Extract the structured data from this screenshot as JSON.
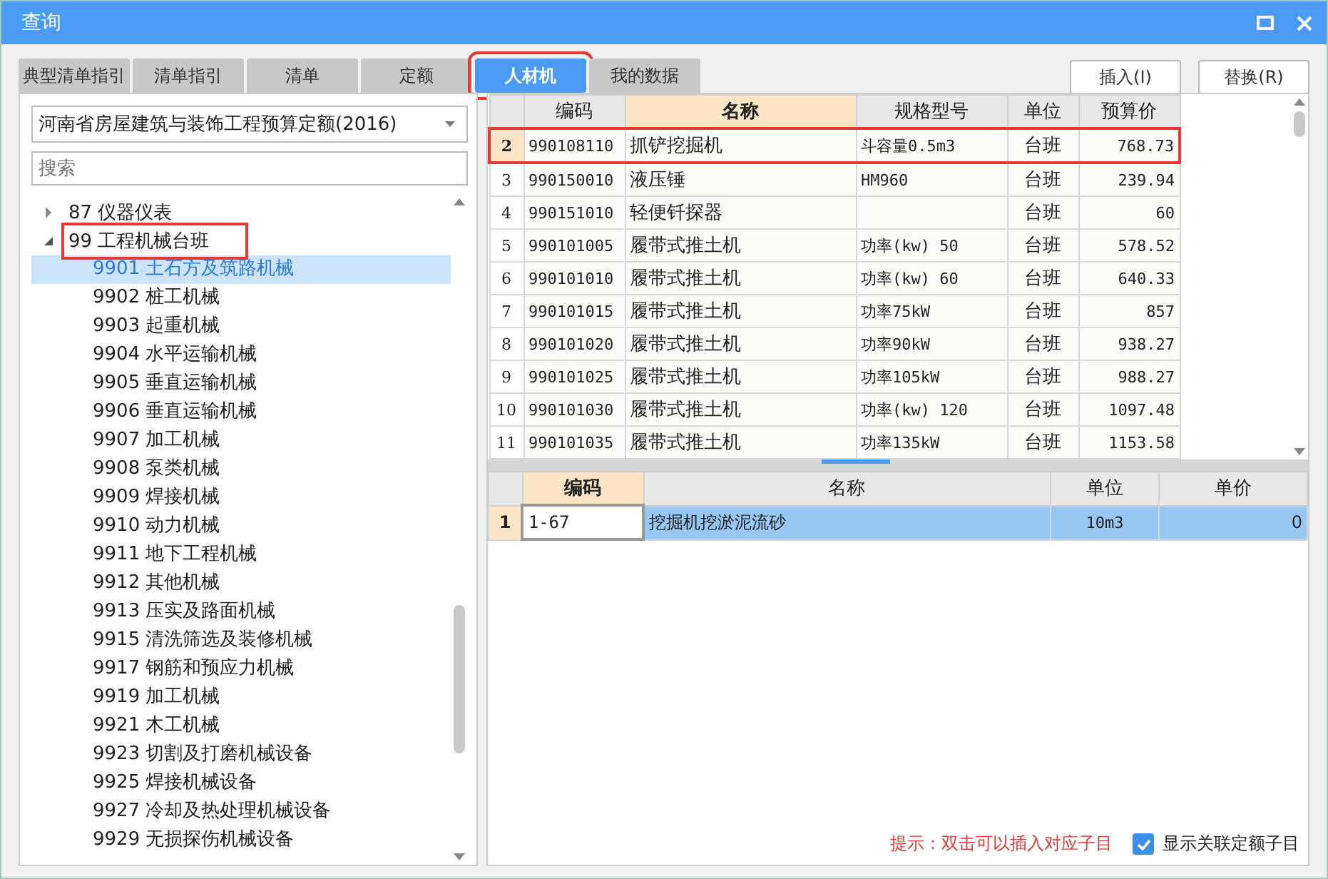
{
  "window": {
    "title": "查询"
  },
  "tabs": [
    {
      "label": "典型清单指引",
      "selected": false,
      "marked": false
    },
    {
      "label": "清单指引",
      "selected": false,
      "marked": false
    },
    {
      "label": "清单",
      "selected": false,
      "marked": false
    },
    {
      "label": "定额",
      "selected": false,
      "marked": false
    },
    {
      "label": "人材机",
      "selected": true,
      "marked": true
    },
    {
      "label": "我的数据",
      "selected": false,
      "marked": false
    }
  ],
  "actions": [
    "插入(I)",
    "替换(R)"
  ],
  "library": {
    "value": "河南省房屋建筑与装饰工程预算定额(2016)"
  },
  "search": {
    "placeholder": "搜索"
  },
  "tree": [
    {
      "label": "87 仪器仪表",
      "expanded": false,
      "selected": false,
      "marked": false
    },
    {
      "label": "99 工程机械台班",
      "expanded": true,
      "selected": false,
      "marked": true,
      "children": [
        {
          "label": "9901 土石方及筑路机械",
          "selected": true
        },
        {
          "label": "9902 桩工机械",
          "selected": false
        },
        {
          "label": "9903 起重机械",
          "selected": false
        },
        {
          "label": "9904 水平运输机械",
          "selected": false
        },
        {
          "label": "9905 垂直运输机械",
          "selected": false
        },
        {
          "label": "9906 垂直运输机械",
          "selected": false
        },
        {
          "label": "9907 加工机械",
          "selected": false
        },
        {
          "label": "9908 泵类机械",
          "selected": false
        },
        {
          "label": "9909 焊接机械",
          "selected": false
        },
        {
          "label": "9910 动力机械",
          "selected": false
        },
        {
          "label": "9911 地下工程机械",
          "selected": false
        },
        {
          "label": "9912 其他机械",
          "selected": false
        },
        {
          "label": "9913 压实及路面机械",
          "selected": false
        },
        {
          "label": "9915 清洗筛选及装修机械",
          "selected": false
        },
        {
          "label": "9917 钢筋和预应力机械",
          "selected": false
        },
        {
          "label": "9919 加工机械",
          "selected": false
        },
        {
          "label": "9921 木工机械",
          "selected": false
        },
        {
          "label": "9923 切割及打磨机械设备",
          "selected": false
        },
        {
          "label": "9925 焊接机械设备",
          "selected": false
        },
        {
          "label": "9927 冷却及热处理机械设备",
          "selected": false
        },
        {
          "label": "9929 无损探伤机械设备",
          "selected": false
        }
      ]
    }
  ],
  "materials": {
    "columns": [
      {
        "label": "编码",
        "highlighted": false
      },
      {
        "label": "名称",
        "highlighted": true
      },
      {
        "label": "规格型号",
        "highlighted": false
      },
      {
        "label": "单位",
        "highlighted": false
      },
      {
        "label": "预算价",
        "highlighted": false
      }
    ],
    "rows": [
      {
        "num": "2",
        "code": "990108110",
        "name": "抓铲挖掘机",
        "spec": "斗容量0.5m3",
        "unit": "台班",
        "price": "768.73",
        "selected": true,
        "marked": true
      },
      {
        "num": "3",
        "code": "990150010",
        "name": "液压锤",
        "spec": "HM960",
        "unit": "台班",
        "price": "239.94",
        "selected": false,
        "marked": false
      },
      {
        "num": "4",
        "code": "990151010",
        "name": "轻便钎探器",
        "spec": "",
        "unit": "台班",
        "price": "60",
        "selected": false,
        "marked": false
      },
      {
        "num": "5",
        "code": "990101005",
        "name": "履带式推土机",
        "spec": "功率(kw)  50",
        "unit": "台班",
        "price": "578.52",
        "selected": false,
        "marked": false
      },
      {
        "num": "6",
        "code": "990101010",
        "name": "履带式推土机",
        "spec": "功率(kw) 60",
        "unit": "台班",
        "price": "640.33",
        "selected": false,
        "marked": false
      },
      {
        "num": "7",
        "code": "990101015",
        "name": "履带式推土机",
        "spec": "功率75kW",
        "unit": "台班",
        "price": "857",
        "selected": false,
        "marked": false
      },
      {
        "num": "8",
        "code": "990101020",
        "name": "履带式推土机",
        "spec": "功率90kW",
        "unit": "台班",
        "price": "938.27",
        "selected": false,
        "marked": false
      },
      {
        "num": "9",
        "code": "990101025",
        "name": "履带式推土机",
        "spec": "功率105kW",
        "unit": "台班",
        "price": "988.27",
        "selected": false,
        "marked": false
      },
      {
        "num": "10",
        "code": "990101030",
        "name": "履带式推土机",
        "spec": "功率(kw)  120",
        "unit": "台班",
        "price": "1097.48",
        "selected": false,
        "marked": false
      },
      {
        "num": "11",
        "code": "990101035",
        "name": "履带式推土机",
        "spec": "功率135kW",
        "unit": "台班",
        "price": "1153.58",
        "selected": false,
        "marked": false
      }
    ]
  },
  "quota": {
    "columns": [
      {
        "label": "编码",
        "highlighted": true
      },
      {
        "label": "名称",
        "highlighted": false
      },
      {
        "label": "单位",
        "highlighted": false
      },
      {
        "label": "单价",
        "highlighted": false
      }
    ],
    "rows": [
      {
        "num": "1",
        "code": "1-67",
        "name": "挖掘机挖淤泥流砂",
        "unit": "10m3",
        "price": "0",
        "selected": true
      }
    ]
  },
  "hint": "提示：双击可以插入对应子目",
  "show_linked": {
    "label": "显示关联定额子目",
    "checked": true
  }
}
